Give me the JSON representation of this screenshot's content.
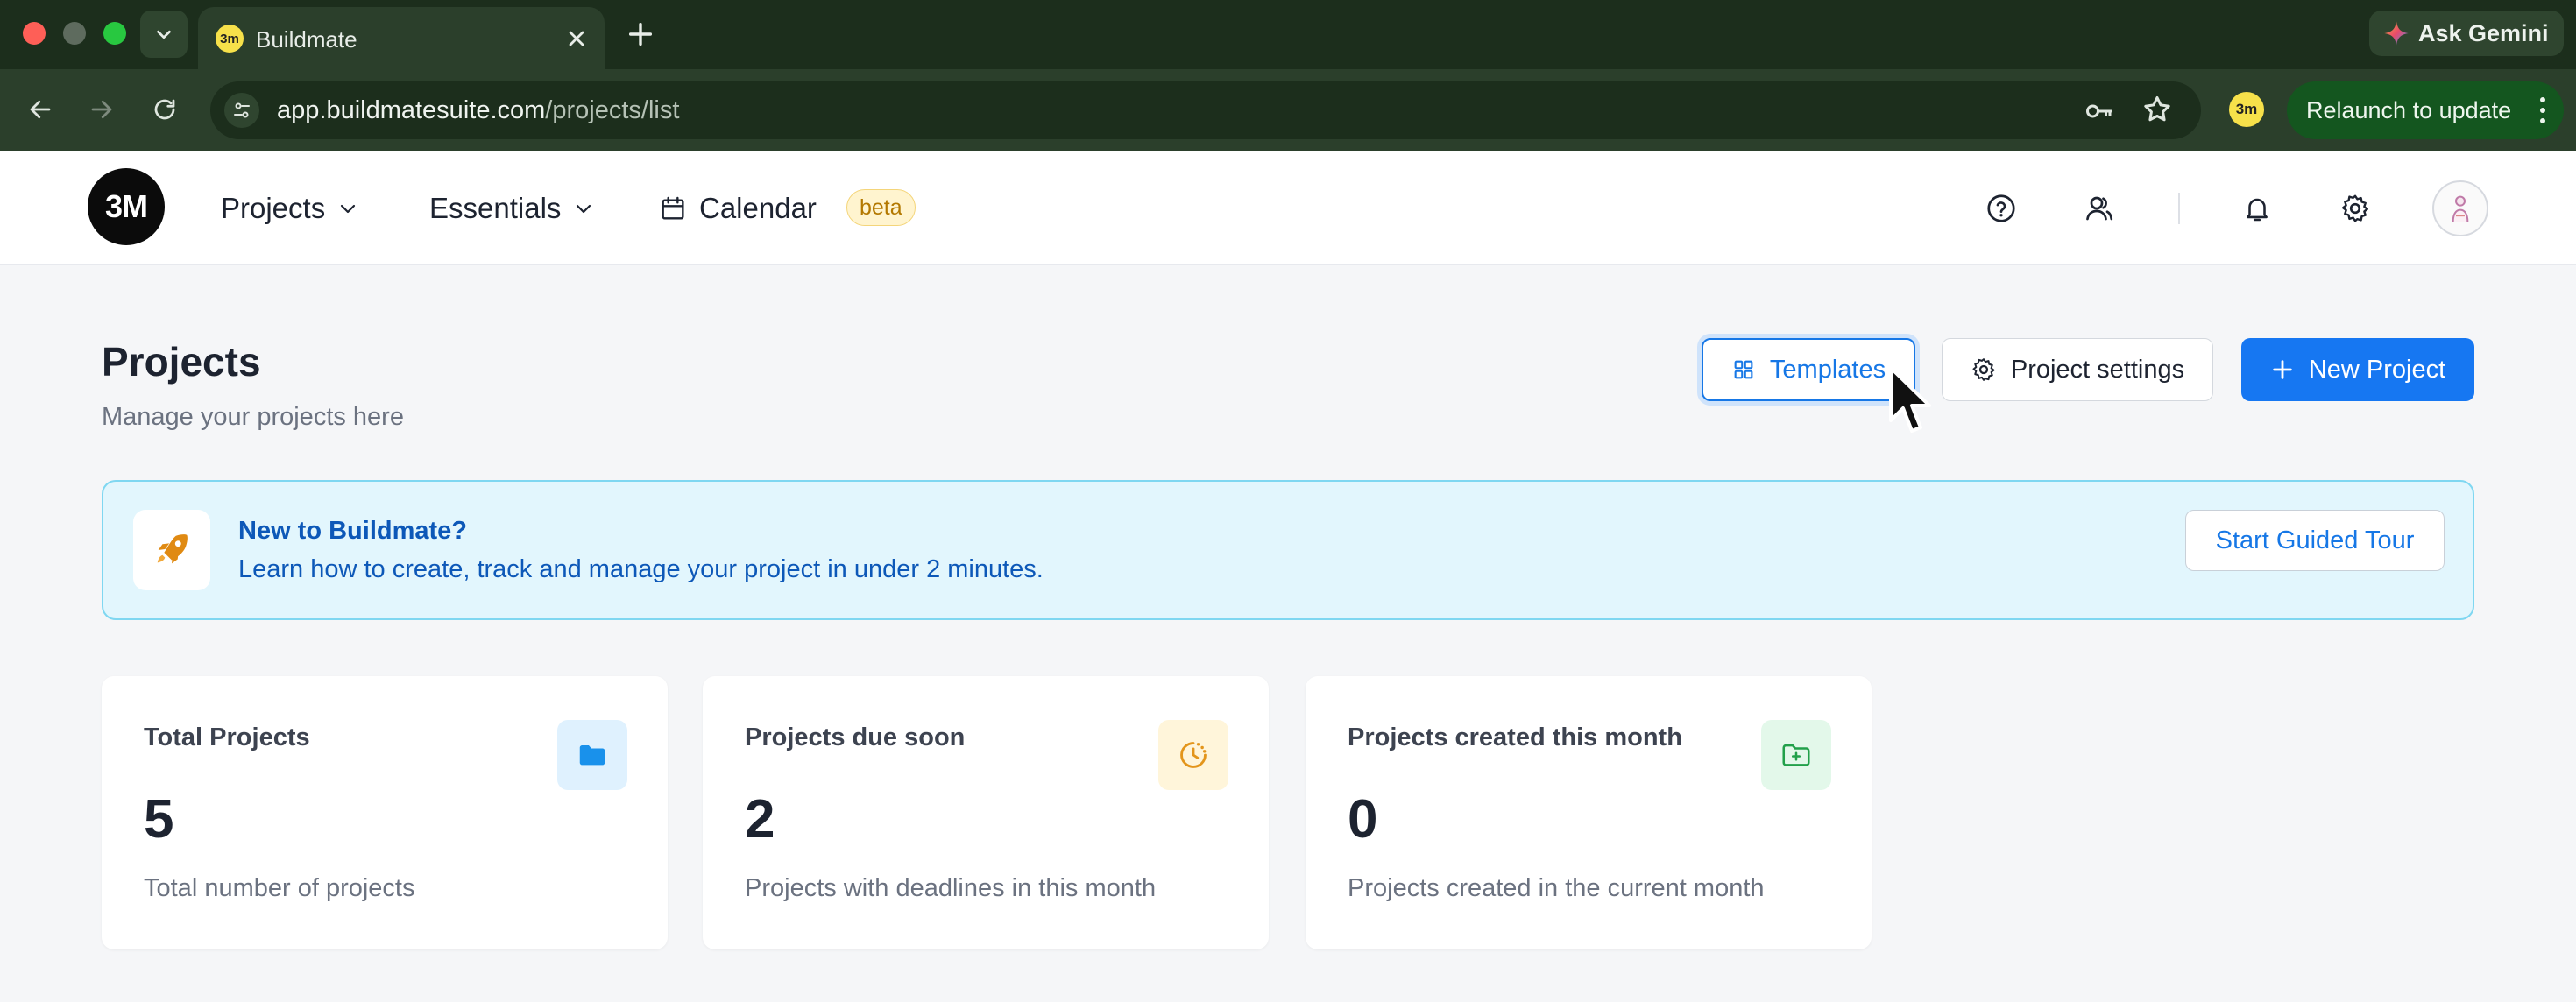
{
  "browser": {
    "tab_title": "Buildmate",
    "favicon_text": "3m",
    "ask_gemini": "Ask Gemini",
    "url_host": "app.buildmatesuite.com",
    "url_path": "/projects/list",
    "relaunch": "Relaunch to update",
    "profile_text": "3m"
  },
  "header": {
    "logo_text": "3M",
    "nav": {
      "projects": "Projects",
      "essentials": "Essentials",
      "calendar": "Calendar",
      "beta": "beta"
    }
  },
  "page": {
    "title": "Projects",
    "subtitle": "Manage your projects here",
    "buttons": {
      "templates": "Templates",
      "project_settings": "Project settings",
      "new_project": "New Project"
    }
  },
  "banner": {
    "title": "New to Buildmate?",
    "text": "Learn how to create, track and manage your project in under 2 minutes.",
    "tour_button": "Start Guided Tour"
  },
  "stats": [
    {
      "label": "Total Projects",
      "value": "5",
      "description": "Total number of projects",
      "icon": "folder-icon"
    },
    {
      "label": "Projects due soon",
      "value": "2",
      "description": "Projects with deadlines in this month",
      "icon": "clock-icon"
    },
    {
      "label": "Projects created this month",
      "value": "0",
      "description": "Projects created in the current month",
      "icon": "folder-plus-icon"
    }
  ],
  "colors": {
    "primary": "#1677f2",
    "banner_bg": "#e2f6fd",
    "banner_text": "#0d58b8",
    "beta_bg": "#fff4cf",
    "browser_frame": "#1c2e1c"
  }
}
